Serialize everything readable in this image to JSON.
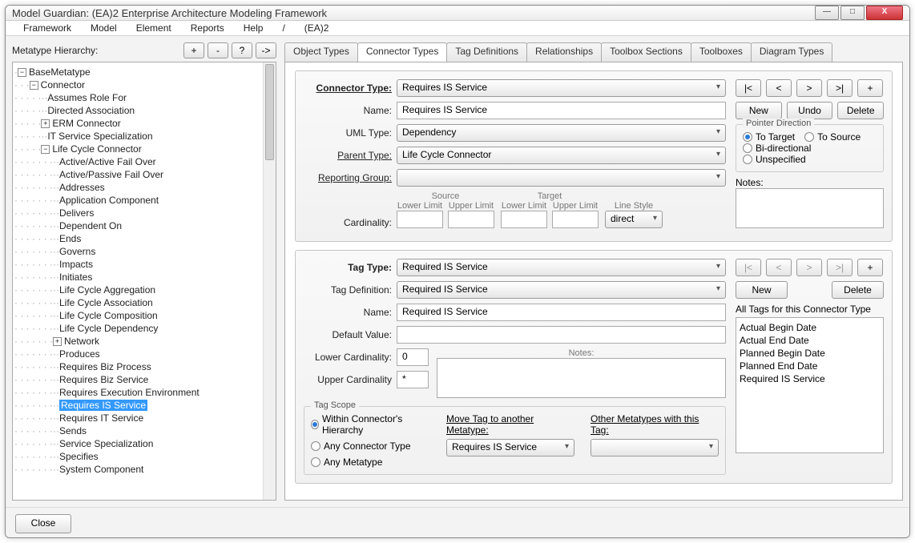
{
  "window": {
    "title": "Model Guardian: (EA)2 Enterprise Architecture Modeling Framework"
  },
  "menubar": [
    "Framework",
    "Model",
    "Element",
    "Reports",
    "Help",
    "/",
    "(EA)2"
  ],
  "left": {
    "title": "Metatype Hierarchy:",
    "btns": [
      "+",
      "-",
      "?",
      "->"
    ],
    "tree": {
      "root": "BaseMetatype",
      "connector": "Connector",
      "items": [
        "Assumes Role For",
        "Directed Association",
        "ERM Connector",
        "IT Service Specialization"
      ],
      "lifecycle": "Life Cycle Connector",
      "lifecycle_children": [
        "Active/Active Fail Over",
        "Active/Passive Fail Over",
        "Addresses",
        "Application Component",
        "Delivers",
        "Dependent On",
        "Ends",
        "Governs",
        "Impacts",
        "Initiates",
        "Life Cycle Aggregation",
        "Life Cycle Association",
        "Life Cycle Composition",
        "Life Cycle Dependency",
        "Network",
        "Produces",
        "Requires Biz Process",
        "Requires Biz Service",
        "Requires Execution Environment",
        "Requires IS Service",
        "Requires IT Service",
        "Sends",
        "Service Specialization",
        "Specifies",
        "System Component"
      ],
      "selected": "Requires IS Service",
      "expandable": {
        "ERM Connector": true,
        "Network": true
      }
    }
  },
  "tabs": [
    "Object Types",
    "Connector Types",
    "Tag Definitions",
    "Relationships",
    "Toolbox Sections",
    "Toolboxes",
    "Diagram Types"
  ],
  "active_tab": "Connector Types",
  "ct": {
    "labels": {
      "connector_type": "Connector Type:",
      "name": "Name:",
      "uml_type": "UML Type:",
      "parent_type": "Parent Type:",
      "reporting_group": "Reporting Group:",
      "cardinality": "Cardinality:"
    },
    "connector_type": "Requires IS Service",
    "name": "Requires IS Service",
    "uml_type": "Dependency",
    "parent_type": "Life Cycle Connector",
    "reporting_group": "",
    "nav": [
      "|<",
      "<",
      ">",
      ">|",
      "+"
    ],
    "actions": {
      "new": "New",
      "undo": "Undo",
      "delete": "Delete"
    },
    "card_headers": {
      "source": "Source",
      "target": "Target",
      "lower": "Lower Limit",
      "upper": "Upper Limit",
      "line_style": "Line Style"
    },
    "line_style": "direct",
    "pointer_title": "Pointer Direction",
    "pointer": {
      "to_target": "To Target",
      "to_source": "To Source",
      "bidir": "Bi-directional",
      "unspec": "Unspecified",
      "selected": "to_target"
    },
    "notes_label": "Notes:"
  },
  "tt": {
    "labels": {
      "tag_type": "Tag Type:",
      "tag_def": "Tag Definition:",
      "name": "Name:",
      "default": "Default Value:",
      "lower": "Lower Cardinality:",
      "upper": "Upper Cardinality",
      "notes": "Notes:"
    },
    "tag_type": "Required IS Service",
    "tag_def": "Required IS Service",
    "name": "Required IS Service",
    "default": "",
    "lower_card": "0",
    "upper_card": "*",
    "nav": [
      "|<",
      "<",
      ">",
      ">|",
      "+"
    ],
    "actions": {
      "new": "New",
      "delete": "Delete"
    },
    "all_tags_title": "All Tags for this Connector Type",
    "all_tags": [
      "Actual Begin Date",
      "Actual End Date",
      "Planned Begin Date",
      "Planned End Date",
      "Required IS Service"
    ],
    "scope_title": "Tag Scope",
    "scope": {
      "within": "Within Connector's Hierarchy",
      "any_conn": "Any Connector Type",
      "any_meta": "Any Metatype",
      "move": "Move Tag to another Metatype:",
      "other": "Other Metatypes with this Tag:",
      "move_val": "Requires IS Service",
      "selected": "within"
    }
  },
  "footer": {
    "close": "Close"
  }
}
